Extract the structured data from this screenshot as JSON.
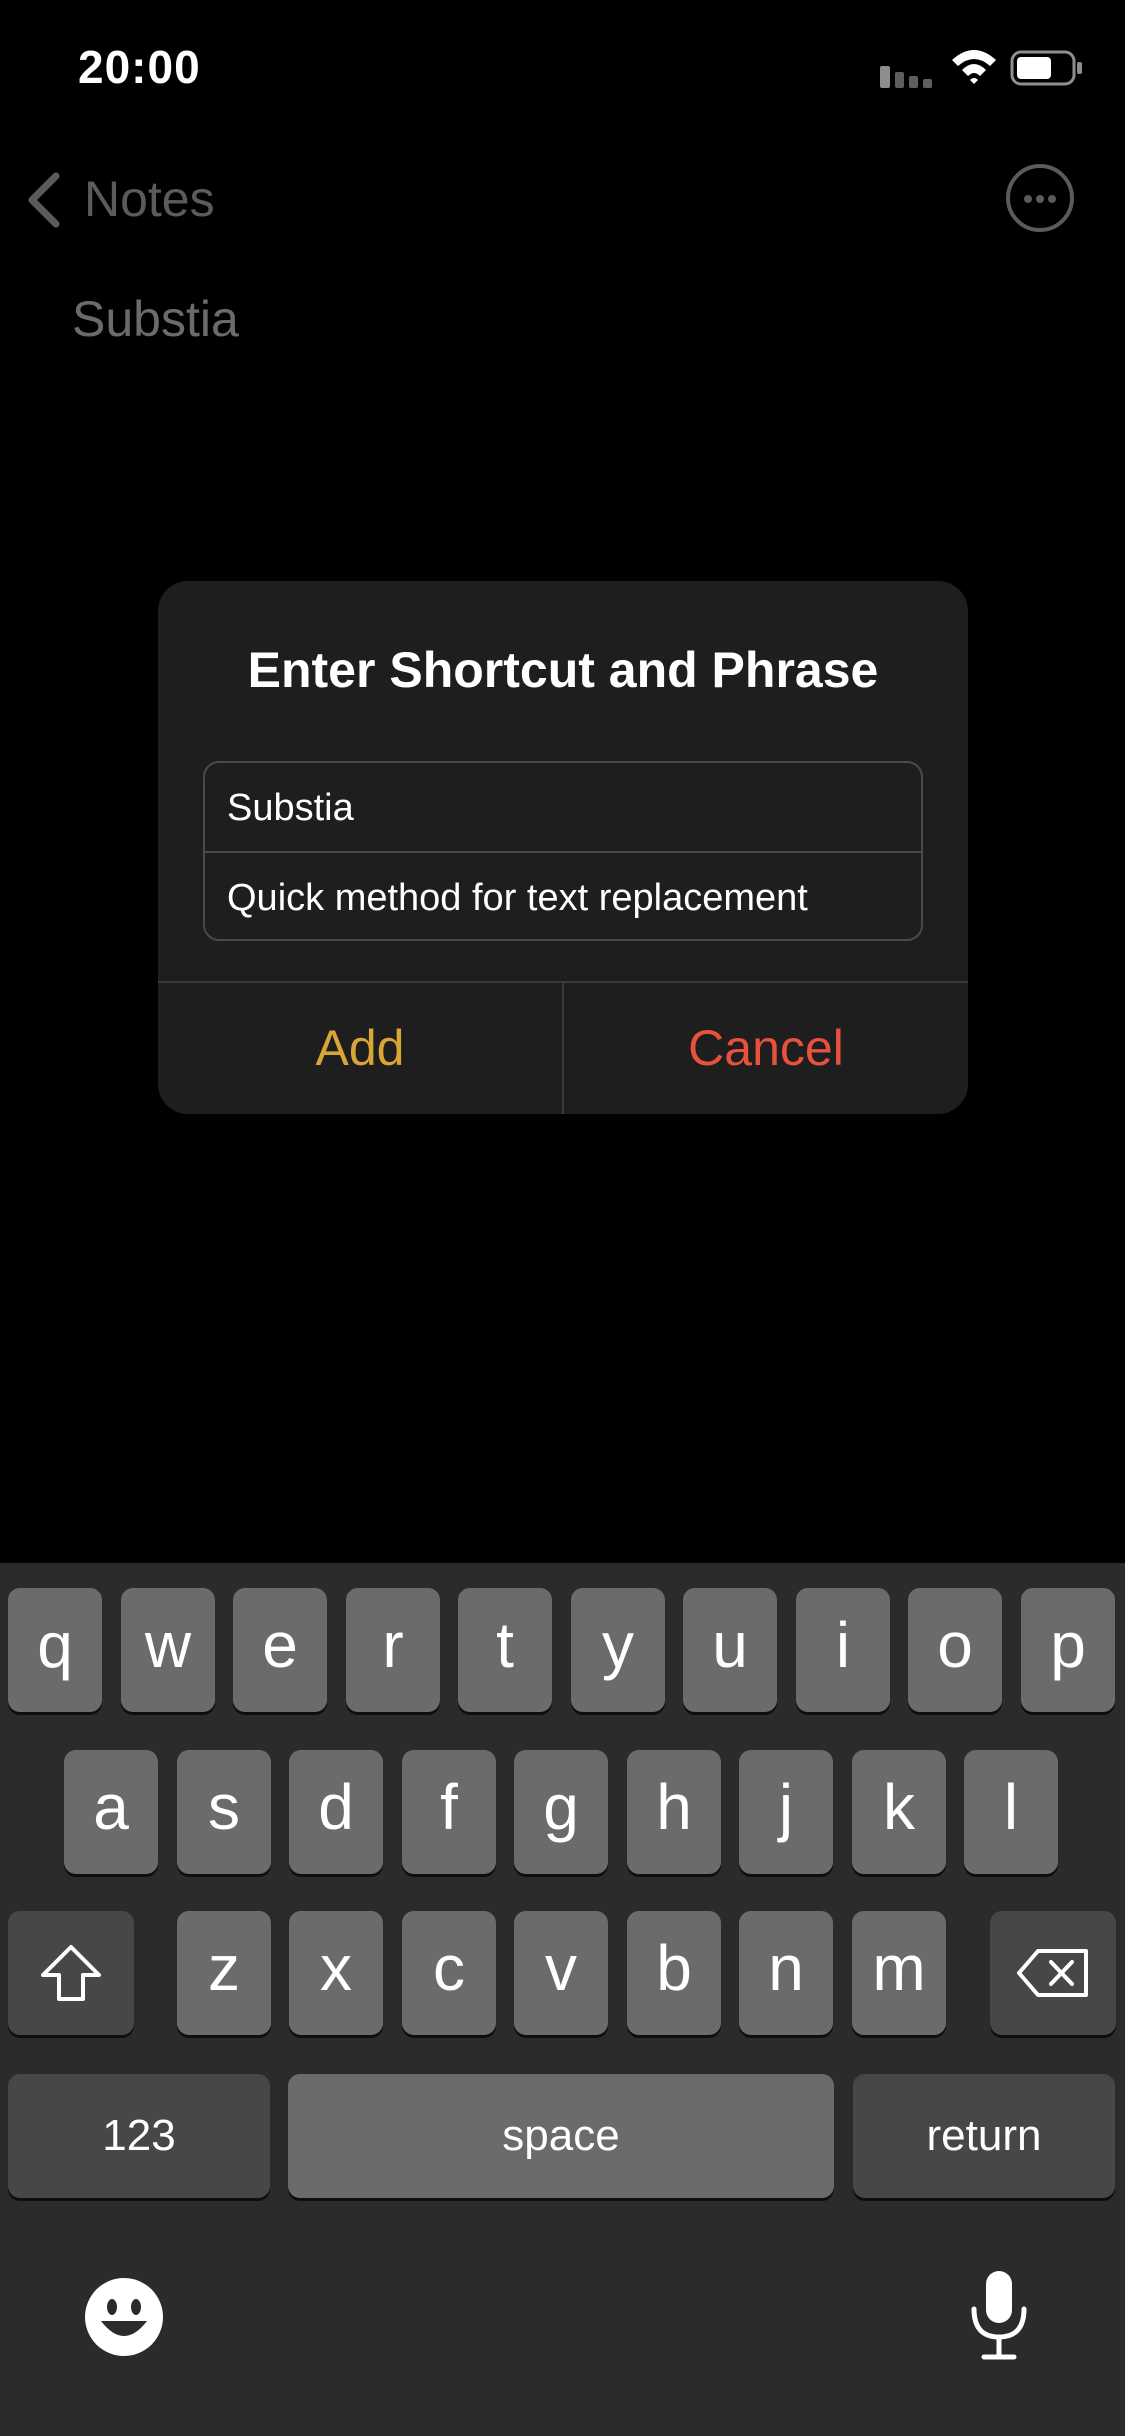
{
  "status_bar": {
    "time": "20:00",
    "icons": [
      "signal-icon",
      "wifi-icon",
      "battery-icon"
    ]
  },
  "nav": {
    "back_label": "Notes",
    "icons": [
      "chevron-left-icon",
      "more-icon"
    ]
  },
  "note": {
    "body_text": "Substia"
  },
  "alert": {
    "title": "Enter Shortcut and Phrase",
    "shortcut_value": "Substia",
    "phrase_value": "Quick method for text replacement",
    "add_label": "Add",
    "cancel_label": "Cancel"
  },
  "keyboard": {
    "row1": [
      "q",
      "w",
      "e",
      "r",
      "t",
      "y",
      "u",
      "i",
      "o",
      "p"
    ],
    "row2": [
      "a",
      "s",
      "d",
      "f",
      "g",
      "h",
      "j",
      "k",
      "l"
    ],
    "row3": [
      "z",
      "x",
      "c",
      "v",
      "b",
      "n",
      "m"
    ],
    "numbers_label": "123",
    "space_label": "space",
    "return_label": "return",
    "icons": [
      "shift-icon",
      "delete-icon",
      "emoji-icon",
      "microphone-icon"
    ]
  },
  "colors": {
    "add": "#d8a637",
    "cancel": "#e8513e",
    "keyboard_bg": "#2b2b2b",
    "key": "#6b6b6b",
    "special_key": "#474747"
  }
}
